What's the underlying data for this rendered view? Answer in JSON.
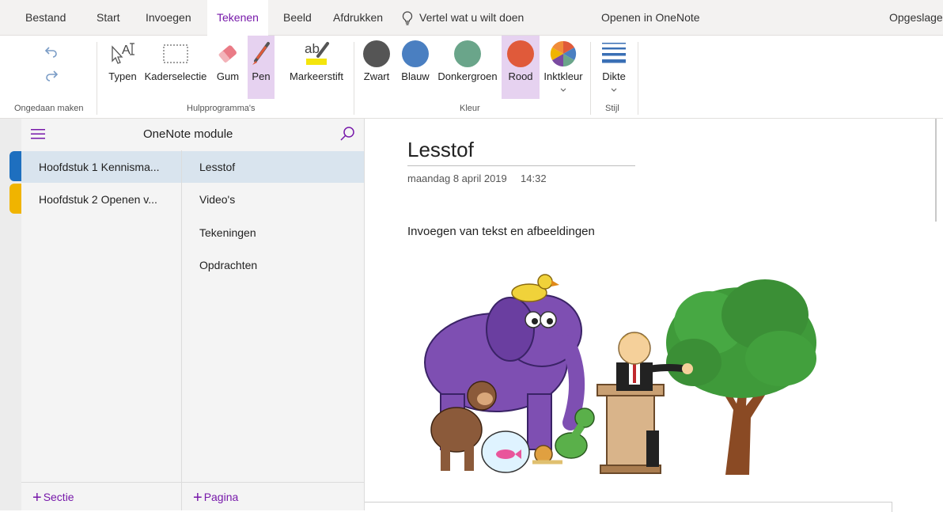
{
  "tabs": {
    "bestand": "Bestand",
    "start": "Start",
    "invoegen": "Invoegen",
    "tekenen": "Tekenen",
    "beeld": "Beeld",
    "afdrukken": "Afdrukken",
    "tell_me": "Vertel wat u wilt doen",
    "open_onenote": "Openen in OneNote",
    "saved_status": "Opgeslagen"
  },
  "ribbon": {
    "undo_group": "Ongedaan maken",
    "tools": {
      "group": "Hulpprogramma's",
      "typen": "Typen",
      "kaderselectie": "Kaderselectie",
      "gum": "Gum",
      "pen": "Pen",
      "markeerstift": "Markeerstift"
    },
    "colors": {
      "group": "Kleur",
      "zwart": "Zwart",
      "blauw": "Blauw",
      "donkergroen": "Donkergroen",
      "rood": "Rood",
      "inktkleur": "Inktkleur"
    },
    "style": {
      "group": "Stijl",
      "dikte": "Dikte"
    },
    "color_values": {
      "zwart": "#555555",
      "blauw": "#4a7fc1",
      "donkergroen": "#6aa58a",
      "rood": "#e05a3a"
    },
    "selected_tool": "Pen",
    "selected_color": "Rood"
  },
  "notebook": {
    "title": "OneNote module",
    "sections": [
      {
        "label": "Hoofdstuk 1 Kennisma...",
        "color": "#1e6fbf"
      },
      {
        "label": "Hoofdstuk 2 Openen v...",
        "color": "#f0b400"
      }
    ],
    "pages": [
      "Lesstof",
      "Video's",
      "Tekeningen",
      "Opdrachten"
    ],
    "add_section": "Sectie",
    "add_page": "Pagina"
  },
  "page": {
    "title": "Lesstof",
    "date": "maandag 8 april 2019",
    "time": "14:32",
    "body": "Invoegen van tekst en afbeeldingen"
  },
  "accent_color": "#7719aa"
}
